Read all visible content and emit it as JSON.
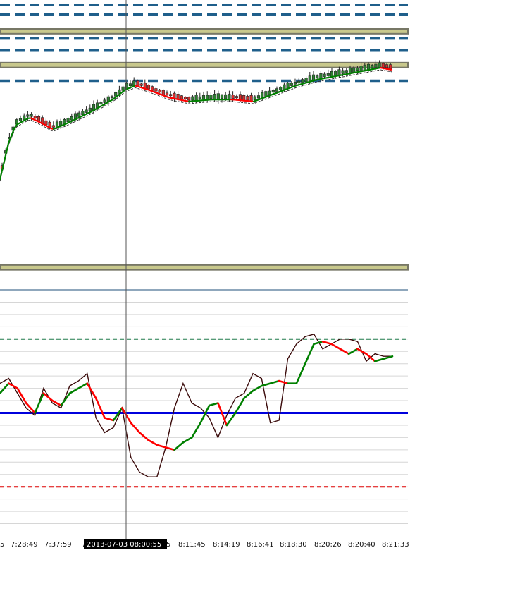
{
  "chart_data": [
    {
      "type": "candlestick",
      "panel": "price",
      "overlays": [
        "moving-average",
        "moving-average-signal"
      ],
      "zones": [
        {
          "from": 0.36,
          "to": 0.38
        },
        {
          "from": 0.22,
          "to": 0.24
        },
        {
          "from": -0.62,
          "to": -0.6
        }
      ],
      "dashed_levels": [
        0.48,
        0.44,
        0.34,
        0.29,
        0.165
      ],
      "ylim": [
        -0.7,
        0.5
      ],
      "colors": {
        "zone": "#c8c88c",
        "zone_border": "#777766",
        "level": "#1f5f8b",
        "bull": "#2e7d32",
        "bear": "#d32f2f",
        "ma_up": "#008000",
        "ma_down": "#ff0000"
      }
    },
    {
      "type": "line",
      "panel": "oscillator",
      "ylim": [
        0,
        100
      ],
      "grid": true,
      "levels": [
        {
          "value": 80,
          "color": "#1f7a4a",
          "style": "dashed"
        },
        {
          "value": 50,
          "color": "#0000dd",
          "style": "solid"
        },
        {
          "value": 20,
          "color": "#dd0000",
          "style": "dashed"
        }
      ],
      "series": [
        {
          "values": [
            58,
            62,
            60,
            54,
            50,
            58,
            55,
            53,
            58,
            60,
            62,
            56,
            48,
            47,
            52,
            46,
            42,
            39,
            37,
            36,
            35,
            38,
            40,
            46,
            53,
            54,
            45,
            50,
            56,
            59,
            61,
            62,
            63,
            62,
            62,
            70,
            78,
            79,
            78,
            76,
            74,
            76,
            74,
            71,
            72,
            73
          ]
        },
        {
          "values": [
            62,
            64,
            58,
            52,
            49,
            60,
            54,
            52,
            61,
            63,
            66,
            48,
            42,
            44,
            52,
            32,
            26,
            24,
            24,
            36,
            52,
            62,
            54,
            52,
            48,
            40,
            49,
            56,
            58,
            66,
            64,
            46,
            47,
            72,
            78,
            81,
            82,
            76,
            78,
            80,
            80,
            79,
            71,
            74,
            73,
            73
          ]
        }
      ]
    }
  ],
  "x_axis": {
    "tick_labels": [
      "5",
      "7:28:49",
      "7:37:59",
      "7:",
      "5",
      "8:11:45",
      "8:14:19",
      "8:16:41",
      "8:18:30",
      "8:20:26",
      "8:20:40",
      "8:21:33"
    ]
  },
  "cursor": {
    "label": "2013-07-03 08:00:55"
  }
}
